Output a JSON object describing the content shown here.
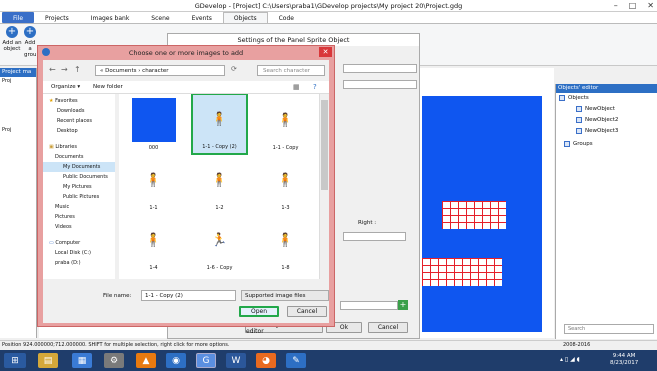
{
  "window": {
    "title": "GDevelop - [Project] C:\\Users\\praba1\\GDevelop projects\\My project 20\\Project.gdg"
  },
  "ribbon_tabs": [
    "File",
    "Projects",
    "Images bank",
    "Scene",
    "Events",
    "Objects",
    "Code"
  ],
  "ribbon": {
    "add_object": "Add an object",
    "add_group": "Add a group"
  },
  "left_panel": {
    "title": "Project ma",
    "items": [
      "Proj",
      "Proj"
    ]
  },
  "right_panel": {
    "title": "Objects' editor",
    "root": "Objects",
    "objects": [
      "NewObject",
      "NewObject2",
      "NewObject3"
    ],
    "groups": "Groups",
    "search_placeholder": "Search"
  },
  "settings": {
    "title": "Settings of the Panel Sprite Object",
    "right_label": "Right :",
    "show_bank": "Show image bank's editor",
    "ok": "Ok",
    "cancel": "Cancel"
  },
  "dialog": {
    "title": "Choose one or more images to add",
    "breadcrumb": "«  Documents  ›  character",
    "search_placeholder": "Search character",
    "organize": "Organize ▾",
    "new_folder": "New folder",
    "nav_items": [
      "Favorites",
      "Downloads",
      "Recent places",
      "Desktop",
      "Libraries",
      "Documents",
      "My Documents",
      "Public Documents",
      "My Pictures",
      "Public Pictures",
      "Music",
      "Pictures",
      "Videos",
      "Computer",
      "Local Disk (C:)",
      "praba (D:)"
    ],
    "files": [
      "000",
      "1-1 - Copy (2)",
      "1-1 - Copy",
      "1-1",
      "1-2",
      "1-3",
      "1-4",
      "1-6 - Copy",
      "1-8"
    ],
    "file_name_label": "File name:",
    "file_name_value": "1-1 - Copy (2)",
    "file_type": "Supported image files",
    "open": "Open",
    "cancel": "Cancel"
  },
  "status": {
    "text": "Position 924.000000;712.000000. SHIFT for multiple selection, right click for more options.",
    "right": "2008-2016"
  },
  "clock": {
    "time": "9:44 AM",
    "date": "8/23/2017"
  },
  "colors": {
    "accent": "#2d6fc4",
    "canvas": "#0f56f0",
    "highlight": "#22a84a",
    "close": "#d9373a"
  }
}
